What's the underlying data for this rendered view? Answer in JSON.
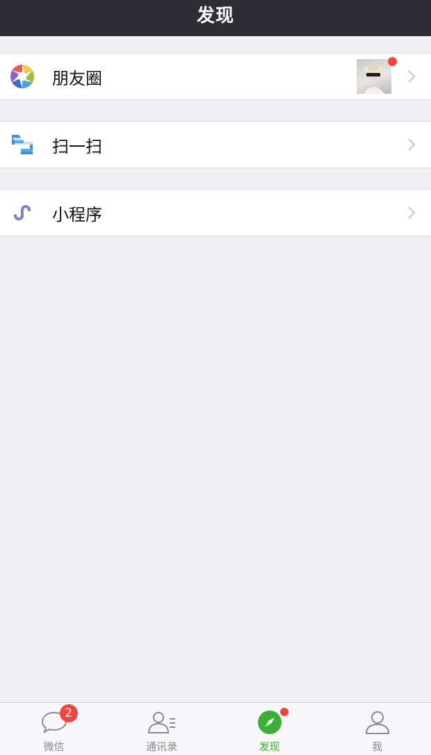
{
  "nav": {
    "title": "发现"
  },
  "menu": {
    "moments": {
      "label": "朋友圈",
      "icon": "moments-aperture-icon",
      "has_thumbnail": true,
      "has_dot": true
    },
    "scan": {
      "label": "扫一扫",
      "icon": "scan-icon"
    },
    "mini_programs": {
      "label": "小程序",
      "icon": "mini-program-icon"
    }
  },
  "tabs": [
    {
      "label": "微信",
      "icon": "chat-bubble-icon",
      "badge": "2",
      "active": false
    },
    {
      "label": "通讯录",
      "icon": "contacts-icon",
      "active": false
    },
    {
      "label": "发现",
      "icon": "compass-icon",
      "has_dot": true,
      "active": true
    },
    {
      "label": "我",
      "icon": "person-icon",
      "active": false
    }
  ],
  "colors": {
    "nav_bg": "#2e2d33",
    "page_bg": "#efeff4",
    "accent_green": "#3cb034",
    "badge_red": "#f5433e",
    "tab_inactive": "#8a8a8a"
  }
}
